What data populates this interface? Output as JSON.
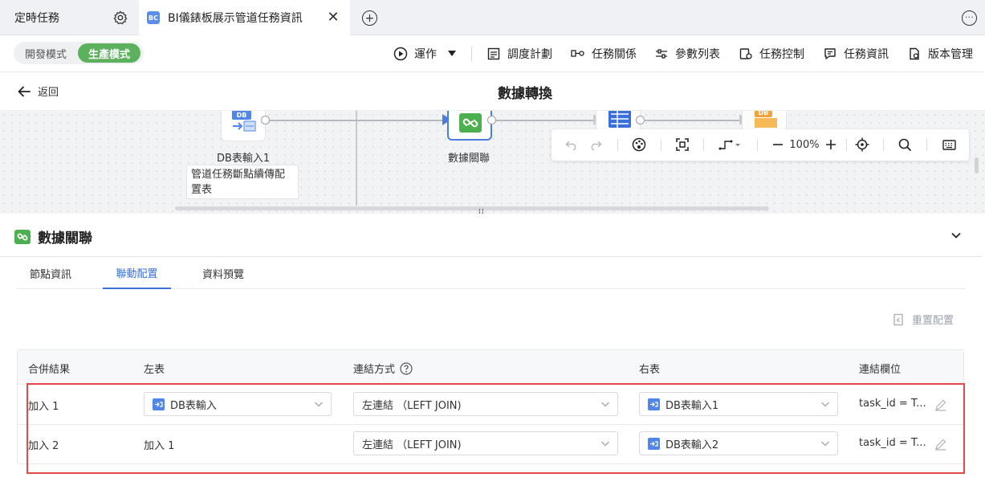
{
  "tabs": {
    "tab1_label": "定時任務",
    "tab2_badge": "BC",
    "tab2_label": "BI儀錶板展示管道任務資訊"
  },
  "toolbar": {
    "mode_dev": "開發模式",
    "mode_prod": "生產模式",
    "run": "運作",
    "schedule": "調度計劃",
    "relation": "任務關係",
    "params": "參數列表",
    "control": "任務控制",
    "info": "任務資訊",
    "version": "版本管理"
  },
  "header": {
    "back": "返回",
    "title": "數據轉換"
  },
  "canvas": {
    "node1_icon": "DB",
    "node1_label": "DB表輸入1",
    "node1_note": "管道任務斷點續傳配置表",
    "node2_label": "數據關聯",
    "node4_icon": "DB",
    "zoom": "100%"
  },
  "panel": {
    "title": "數據關聯",
    "tabs": [
      "節點資訊",
      "聯動配置",
      "資料預覽"
    ],
    "reset": "重置配置"
  },
  "table": {
    "headers": [
      "合併結果",
      "左表",
      "連結方式",
      "右表",
      "連結欄位"
    ],
    "rows": [
      {
        "result": "加入 1",
        "left": "DB表輸入",
        "join": "左連結 （LEFT JOIN)",
        "right": "DB表輸入1",
        "fields": "task_id = T..."
      },
      {
        "result": "加入 2",
        "left": "加入 1",
        "join": "左連結 （LEFT JOIN)",
        "right": "DB表輸入2",
        "fields": "task_id = T..."
      }
    ]
  },
  "colors": {
    "accent": "#3a6fd8",
    "prod_mode": "#5db05d",
    "highlight": "#e54848"
  }
}
